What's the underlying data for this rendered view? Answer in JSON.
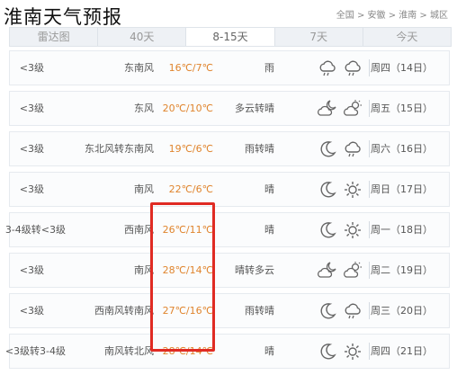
{
  "page": {
    "title": "淮南天气预报",
    "breadcrumb": "全国 > 安徽 > 淮南 > 城区"
  },
  "tabs": [
    {
      "label": "今天"
    },
    {
      "label": "7天"
    },
    {
      "label": "8-15天"
    },
    {
      "label": "40天"
    },
    {
      "label": "雷达图"
    }
  ],
  "active_tab": "8-15天",
  "colors": {
    "temp": "#e0852e",
    "highlight": "#e02b23"
  },
  "forecast": [
    {
      "day": "周四（14日）",
      "icon_day": "cloud-rain-icon",
      "icon_night": "cloud-rain-icon",
      "desc": "雨",
      "temp": "16℃/7℃",
      "wind": "东南风",
      "level": "<3级"
    },
    {
      "day": "周五（15日）",
      "icon_day": "partly-cloudy-icon",
      "icon_night": "partly-cloudy-night-icon",
      "desc": "多云转晴",
      "temp": "20℃/10℃",
      "wind": "东风",
      "level": "<3级"
    },
    {
      "day": "周六（16日）",
      "icon_day": "cloud-rain-icon",
      "icon_night": "moon-icon",
      "desc": "雨转晴",
      "temp": "19℃/6℃",
      "wind": "东北风转东南风",
      "level": "<3级"
    },
    {
      "day": "周日（17日）",
      "icon_day": "sun-icon",
      "icon_night": "moon-icon",
      "desc": "晴",
      "temp": "22℃/6℃",
      "wind": "南风",
      "level": "<3级"
    },
    {
      "day": "周一（18日）",
      "icon_day": "sun-icon",
      "icon_night": "moon-icon",
      "desc": "晴",
      "temp": "26℃/11℃",
      "wind": "西南风",
      "level": "3-4级转<3级"
    },
    {
      "day": "周二（19日）",
      "icon_day": "partly-cloudy-icon",
      "icon_night": "partly-cloudy-night-icon",
      "desc": "晴转多云",
      "temp": "28℃/14℃",
      "wind": "南风",
      "level": "<3级"
    },
    {
      "day": "周三（20日）",
      "icon_day": "cloud-rain-icon",
      "icon_night": "moon-icon",
      "desc": "雨转晴",
      "temp": "27℃/16℃",
      "wind": "西南风转南风",
      "level": "<3级"
    },
    {
      "day": "周四（21日）",
      "icon_day": "sun-icon",
      "icon_night": "moon-icon",
      "desc": "晴",
      "temp": "28℃/14℃",
      "wind": "南风转北风",
      "level": "<3级转3-4级"
    }
  ]
}
